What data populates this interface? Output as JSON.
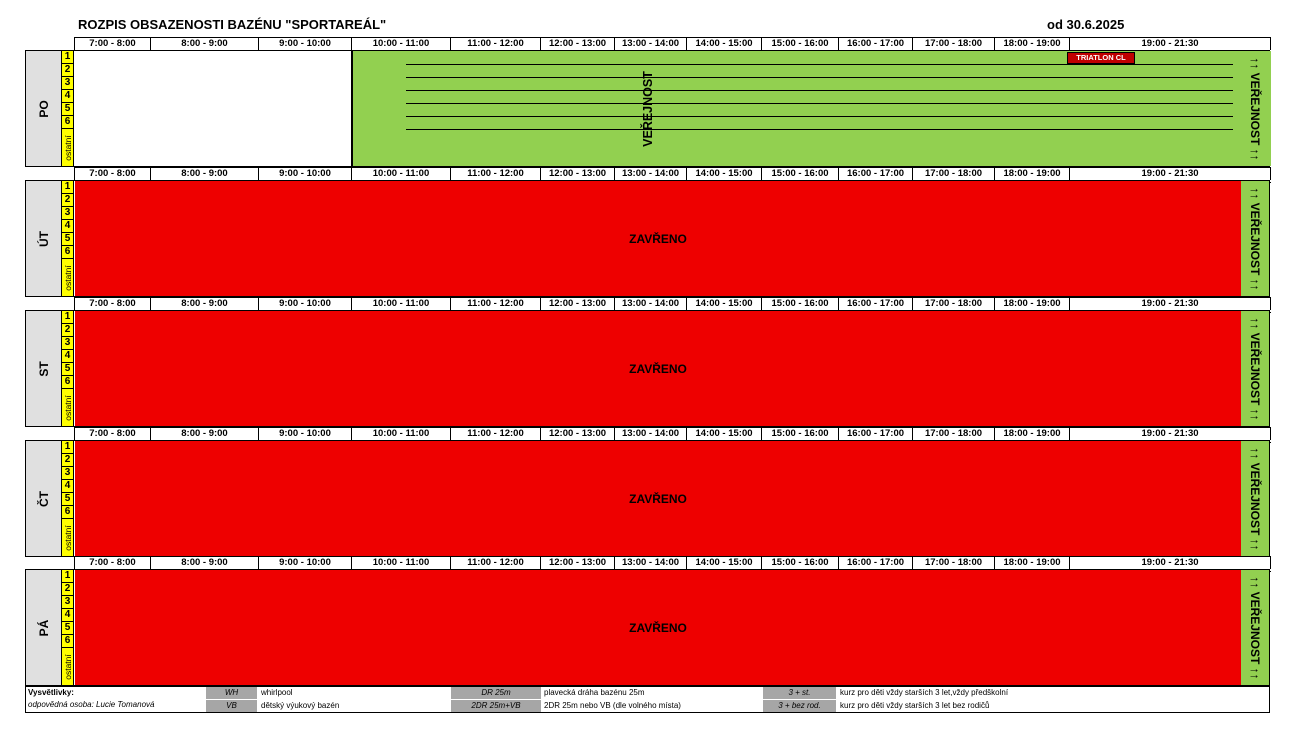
{
  "header": {
    "title": "ROZPIS OBSAZENOSTI BAZÉNU \"SPORTAREÁL\"",
    "date": "od 30.6.2025"
  },
  "time_slots": [
    "7:00 - 8:00",
    "8:00 - 9:00",
    "9:00 - 10:00",
    "10:00 - 11:00",
    "11:00 - 12:00",
    "12:00 - 13:00",
    "13:00 - 14:00",
    "14:00 - 15:00",
    "15:00 - 16:00",
    "16:00 - 17:00",
    "17:00 - 18:00",
    "18:00 - 19:00",
    "19:00 - 21:30"
  ],
  "lanes": [
    "1",
    "2",
    "3",
    "4",
    "5",
    "6"
  ],
  "lane_other": "ostatní",
  "public_label": "VEŘEJNOST",
  "side_public_label": "↑↑ VEŘEJNOST ↑↑",
  "days": [
    {
      "name": "PO",
      "status": "VEŘEJNOST",
      "note": "TRIATLON CL"
    },
    {
      "name": "ÚT",
      "status": "ZAVŘENO"
    },
    {
      "name": "ST",
      "status": "ZAVŘENO"
    },
    {
      "name": "ČT",
      "status": "ZAVŘENO"
    },
    {
      "name": "PÁ",
      "status": "ZAVŘENO"
    }
  ],
  "legend": {
    "title": "Vysvětlivky:",
    "responsible": "odpovědná osoba: Lucie Tomanová",
    "items": [
      {
        "code": "WH",
        "text": "whirlpool"
      },
      {
        "code": "VB",
        "text": "dětský výukový bazén"
      },
      {
        "code": "DR 25m",
        "text": "plavecká dráha bazénu 25m"
      },
      {
        "code": "2DR 25m+VB",
        "text": "2DR 25m nebo VB (dle volného místa)"
      },
      {
        "code": "3 + st.",
        "text": "kurz pro děti vždy starších 3 let,vždy předškolní"
      },
      {
        "code": "3 + bez rod.",
        "text": "kurz pro děti vždy starších 3 let bez rodičů"
      }
    ]
  },
  "colors": {
    "closed": "#ee0000",
    "public": "#92d050",
    "lanes": "#ffff00",
    "day_label": "#e0e0e0",
    "note": "#c00000",
    "legend_code": "#a6a6a6"
  }
}
